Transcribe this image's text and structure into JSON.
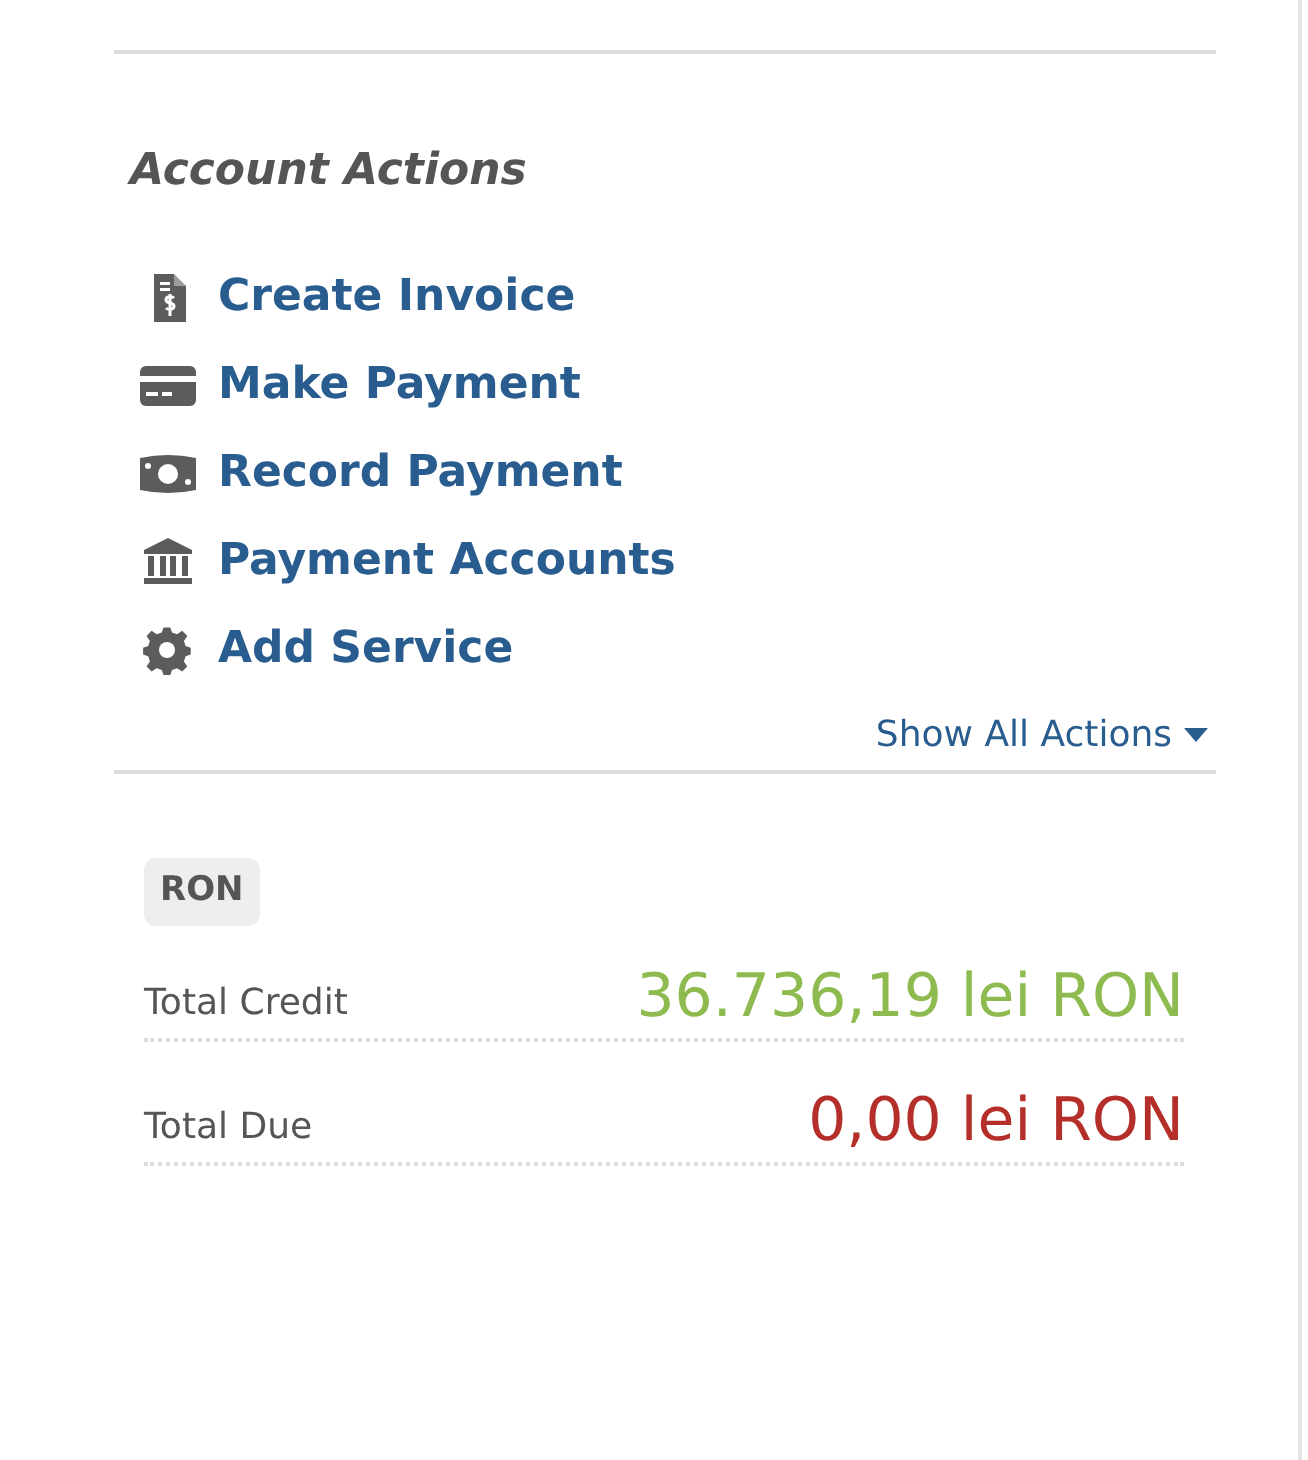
{
  "section_title": "Account Actions",
  "actions": [
    {
      "kind": "invoice",
      "label": "Create Invoice"
    },
    {
      "kind": "card",
      "label": "Make Payment"
    },
    {
      "kind": "money",
      "label": "Record Payment"
    },
    {
      "kind": "bank",
      "label": "Payment Accounts"
    },
    {
      "kind": "gear",
      "label": "Add Service"
    }
  ],
  "show_all": {
    "label": "Show All Actions"
  },
  "currency_badge": "RON",
  "totals": [
    {
      "label": "Total Credit",
      "amount": "36.736,19 lei RON",
      "color": "#8dbb4f"
    },
    {
      "label": "Total Due",
      "amount": "0,00 lei RON",
      "color": "#b52f2a"
    }
  ]
}
